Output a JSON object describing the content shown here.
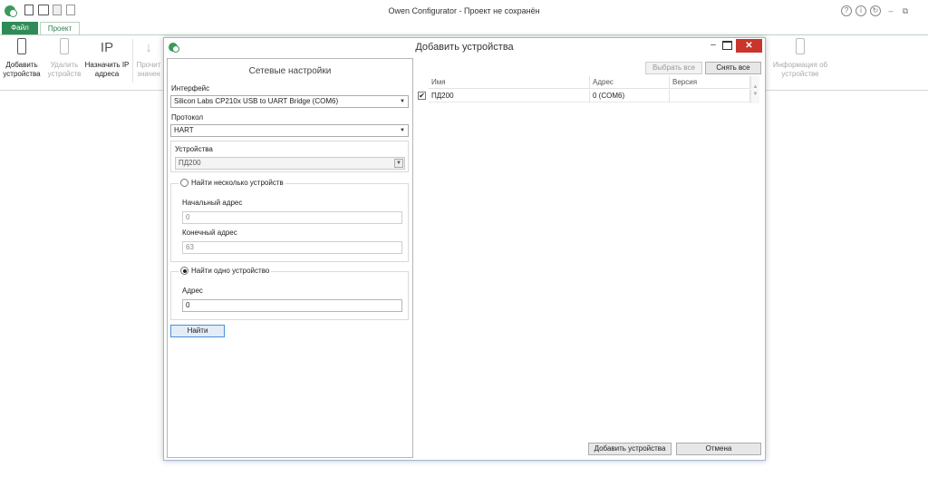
{
  "window": {
    "title": "Owen Configurator - Проект не сохранён",
    "controls": [
      "?",
      "i",
      "↻",
      "–",
      "⧉"
    ]
  },
  "tabs": {
    "file": "Файл",
    "project": "Проект"
  },
  "ribbon": {
    "add_devices": "Добавить устройства",
    "remove_device": "Удалить устройств",
    "assign_ip": "Назначить IP адреса",
    "read_values": "Прочит значен",
    "device_info": "Информация об устройстве"
  },
  "dialog": {
    "title": "Добавить устройства",
    "controls": {
      "minimize": "–",
      "close": "✕"
    },
    "network": {
      "heading": "Сетевые настройки",
      "interface_label": "Интерфейс",
      "interface_value": "Silicon Labs CP210x USB to UART Bridge (COM6)",
      "protocol_label": "Протокол",
      "protocol_value": "HART",
      "devices_label": "Устройства",
      "devices_value": "ПД200",
      "multi": {
        "label": "Найти несколько устройств",
        "start_label": "Начальный адрес",
        "start_value": "0",
        "end_label": "Конечный адрес",
        "end_value": "63"
      },
      "single": {
        "label": "Найти одно устройство",
        "address_label": "Адрес",
        "address_value": "0"
      },
      "find_button": "Найти"
    },
    "list": {
      "select_all": "Выбрать все",
      "deselect_all": "Снять все",
      "columns": [
        "Имя",
        "Адрес",
        "Версия"
      ],
      "rows": [
        {
          "checked": true,
          "name": "ПД200",
          "address": "0 (COM6)",
          "version": ""
        }
      ]
    },
    "buttons": {
      "add": "Добавить устройства",
      "cancel": "Отмена"
    }
  },
  "symbols": {
    "check": "✔",
    "arrow_down": "▼",
    "scroll_up": "▲",
    "scroll_down": "▼",
    "ip_glyph": "IP",
    "download_glyph": "↓"
  }
}
